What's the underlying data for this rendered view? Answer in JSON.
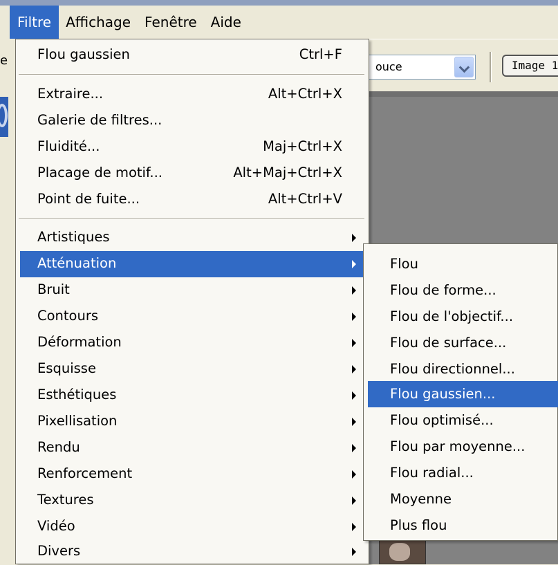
{
  "menubar": [
    {
      "label": "Filtre",
      "active": true
    },
    {
      "label": "Affichage",
      "active": false
    },
    {
      "label": "Fenêtre",
      "active": false
    },
    {
      "label": "Aide",
      "active": false
    }
  ],
  "left_partial_text": "e",
  "options": {
    "combo_value": "ouce",
    "image_button_label": "Image 1("
  },
  "filter_menu": {
    "last_filter": {
      "label": "Flou gaussien",
      "shortcut": "Ctrl+F"
    },
    "commands": [
      {
        "label": "Extraire...",
        "shortcut": "Alt+Ctrl+X"
      },
      {
        "label": "Galerie de filtres...",
        "shortcut": ""
      },
      {
        "label": "Fluidité...",
        "shortcut": "Maj+Ctrl+X"
      },
      {
        "label": "Placage de motif...",
        "shortcut": "Alt+Maj+Ctrl+X"
      },
      {
        "label": "Point de fuite...",
        "shortcut": "Alt+Ctrl+V"
      }
    ],
    "categories": [
      {
        "label": "Artistiques",
        "highlighted": false
      },
      {
        "label": "Atténuation",
        "highlighted": true
      },
      {
        "label": "Bruit",
        "highlighted": false
      },
      {
        "label": "Contours",
        "highlighted": false
      },
      {
        "label": "Déformation",
        "highlighted": false
      },
      {
        "label": "Esquisse",
        "highlighted": false
      },
      {
        "label": "Esthétiques",
        "highlighted": false
      },
      {
        "label": "Pixellisation",
        "highlighted": false
      },
      {
        "label": "Rendu",
        "highlighted": false
      },
      {
        "label": "Renforcement",
        "highlighted": false
      },
      {
        "label": "Textures",
        "highlighted": false
      },
      {
        "label": "Vidéo",
        "highlighted": false
      },
      {
        "label": "Divers",
        "highlighted": false
      }
    ]
  },
  "submenu": {
    "items": [
      {
        "label": "Flou",
        "highlighted": false
      },
      {
        "label": "Flou de forme...",
        "highlighted": false
      },
      {
        "label": "Flou de l'objectif...",
        "highlighted": false
      },
      {
        "label": "Flou de surface...",
        "highlighted": false
      },
      {
        "label": "Flou directionnel...",
        "highlighted": false
      },
      {
        "label": "Flou gaussien...",
        "highlighted": true
      },
      {
        "label": "Flou optimisé...",
        "highlighted": false
      },
      {
        "label": "Flou par moyenne...",
        "highlighted": false
      },
      {
        "label": "Flou radial...",
        "highlighted": false
      },
      {
        "label": "Moyenne",
        "highlighted": false
      },
      {
        "label": "Plus flou",
        "highlighted": false
      }
    ]
  },
  "colors": {
    "highlight": "#316ac5",
    "menu_bg": "#f9f8f3",
    "chrome_bg": "#ece9d8",
    "canvas_gray": "#828282"
  }
}
